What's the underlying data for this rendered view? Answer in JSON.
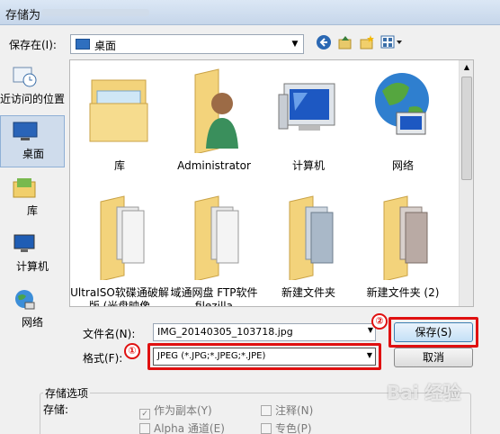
{
  "window": {
    "title": "存储为"
  },
  "toolbar": {
    "save_in_label": "保存在(I):",
    "location": "桌面",
    "back_icon": "back-arrow-icon",
    "up_icon": "up-folder-icon",
    "new_folder_icon": "new-folder-icon",
    "views_icon": "views-menu-icon"
  },
  "places": [
    {
      "label": "近访问的位置",
      "icon": "recent-places-icon"
    },
    {
      "label": "桌面",
      "icon": "desktop-icon",
      "selected": true
    },
    {
      "label": "库",
      "icon": "libraries-icon"
    },
    {
      "label": "计算机",
      "icon": "computer-icon"
    },
    {
      "label": "网络",
      "icon": "network-icon"
    }
  ],
  "files": [
    {
      "name": "库",
      "icon": "libraries-folder-icon"
    },
    {
      "name": "Administrator",
      "icon": "user-folder-icon"
    },
    {
      "name": "计算机",
      "icon": "computer-icon"
    },
    {
      "name": "网络",
      "icon": "network-globe-icon"
    },
    {
      "name": "UltraISO软碟通破解版 (光盘映像",
      "icon": "folder-icon"
    },
    {
      "name": "域通网盘 FTP软件 filezilla",
      "icon": "folder-icon"
    },
    {
      "name": "新建文件夹",
      "icon": "folder-icon"
    },
    {
      "name": "新建文件夹 (2)",
      "icon": "folder-icon"
    }
  ],
  "form": {
    "filename_label": "文件名(N):",
    "filename_value": "IMG_20140305_103718.jpg",
    "format_label": "格式(F):",
    "format_value": "JPEG (*.JPG;*.JPEG;*.JPE)",
    "save_button": "保存(S)",
    "cancel_button": "取消",
    "marker_1": "①",
    "marker_2": "②"
  },
  "options": {
    "group_label": "存储选项",
    "storage_label": "存储:",
    "as_copy": "作为副本(Y)",
    "as_copy_checked": true,
    "alpha": "Alpha 通道(E)",
    "alpha_checked": false,
    "annotations": "注释(N)",
    "annotations_checked": false,
    "spot_color": "专色(P)",
    "spot_color_checked": false
  },
  "watermark": "Bai 经验"
}
